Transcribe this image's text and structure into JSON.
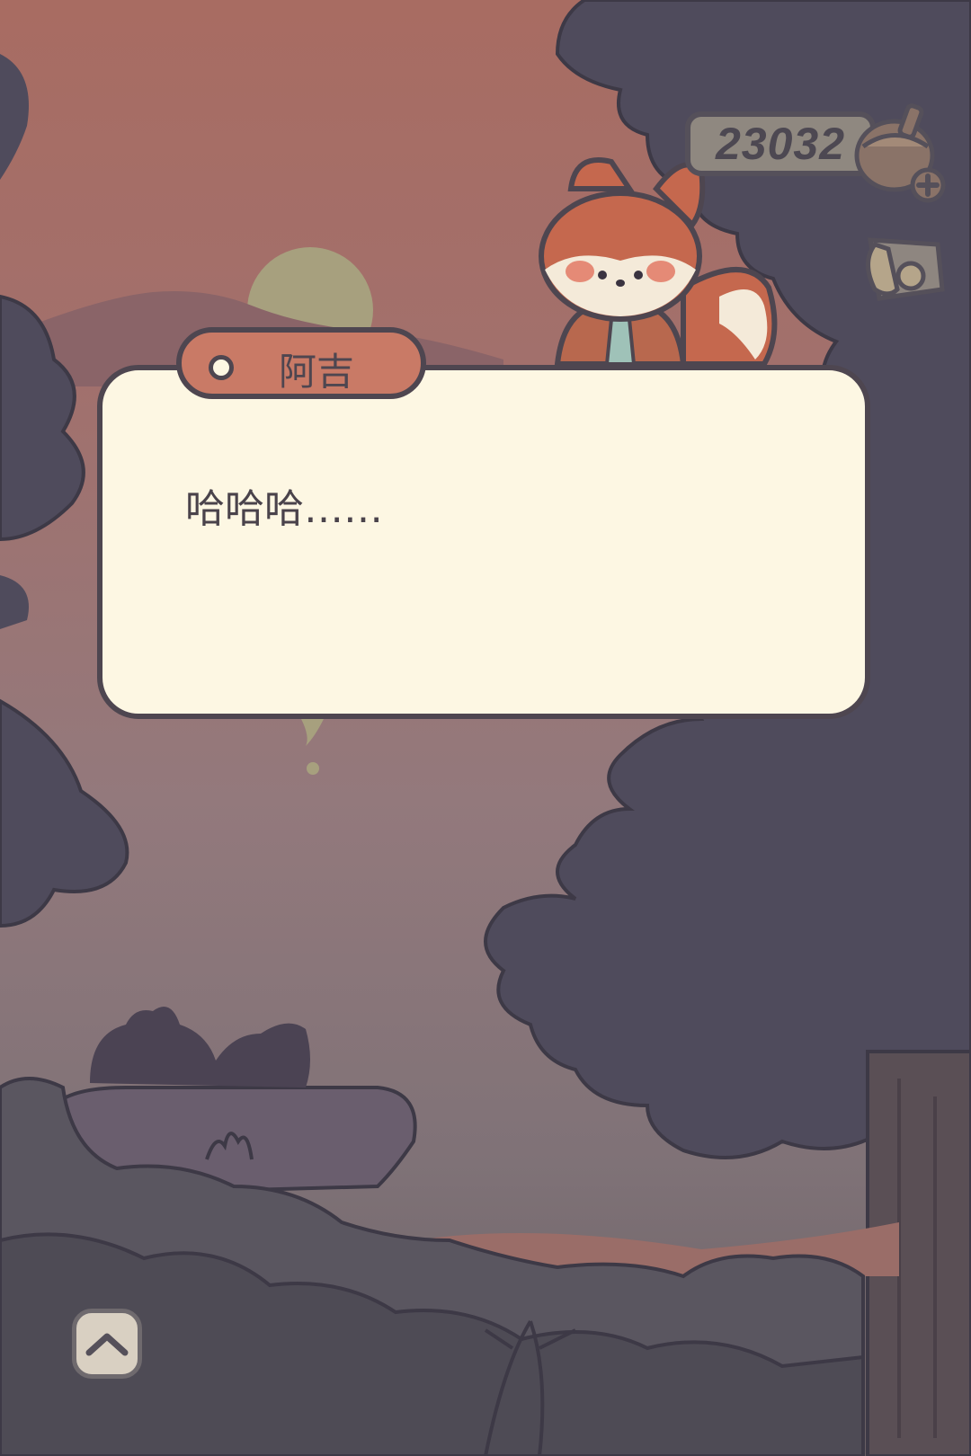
{
  "hud": {
    "currency_value": "23032",
    "currency_icon": "acorn-icon",
    "add_icon": "plus-icon",
    "scroll_icon": "scroll-icon"
  },
  "dialog": {
    "speaker_name": "阿吉",
    "message": "哈哈哈……"
  },
  "controls": {
    "up_icon": "chevron-up-icon"
  },
  "colors": {
    "sky_top": "#a8706a",
    "sky_bottom": "#7f7378",
    "tree": "#4f4b5c",
    "dialog_bg": "#fdf7e3",
    "name_tag": "#c97a66",
    "outline": "#4e4650"
  }
}
